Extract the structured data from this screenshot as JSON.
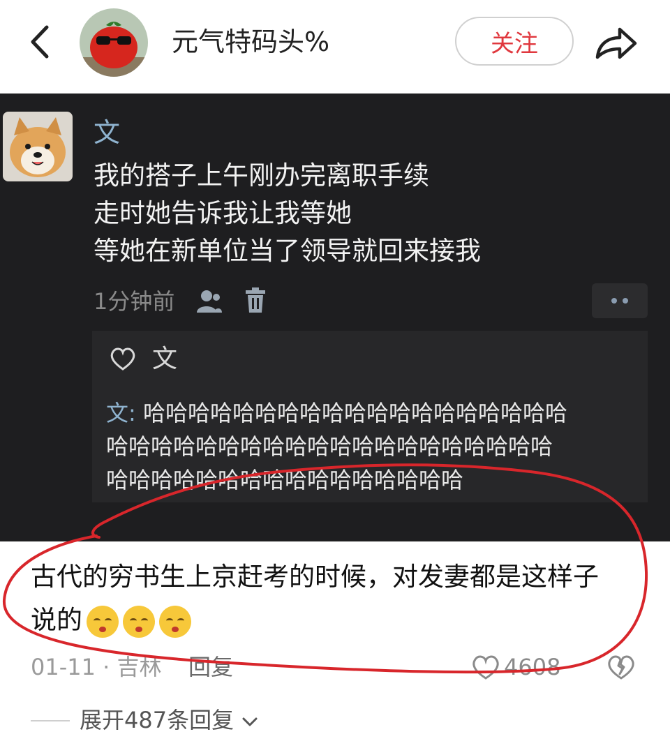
{
  "header": {
    "username": "元气特码头%",
    "follow_label": "关注"
  },
  "screenshot_comment": {
    "author": "文",
    "lines": [
      "我的搭子上午刚办完离职手续",
      "走时她告诉我让我等她",
      "等她在新单位当了领导就回来接我"
    ],
    "time": "1分钟前",
    "reply": {
      "author": "文",
      "prefix": "文:",
      "lines": [
        "哈哈哈哈哈哈哈哈哈哈哈哈哈哈哈哈哈哈哈",
        "哈哈哈哈哈哈哈哈哈哈哈哈哈哈哈哈哈哈哈哈",
        "哈哈哈哈哈哈哈哈哈哈哈哈哈哈哈哈"
      ]
    }
  },
  "comment": {
    "line1": "古代的穷书生上京赶考的时候，对发妻都是这样子",
    "line2": "说的",
    "date": "01-11",
    "separator": "·",
    "location": "吉林",
    "reply_label": "回复",
    "like_count": "4608",
    "expand_label": "展开487条回复"
  },
  "colors": {
    "accent_red": "#e0383e",
    "annotation_red": "#d8262b",
    "dark_bg": "#1e1e20",
    "link_blue": "#8fb3cf"
  }
}
